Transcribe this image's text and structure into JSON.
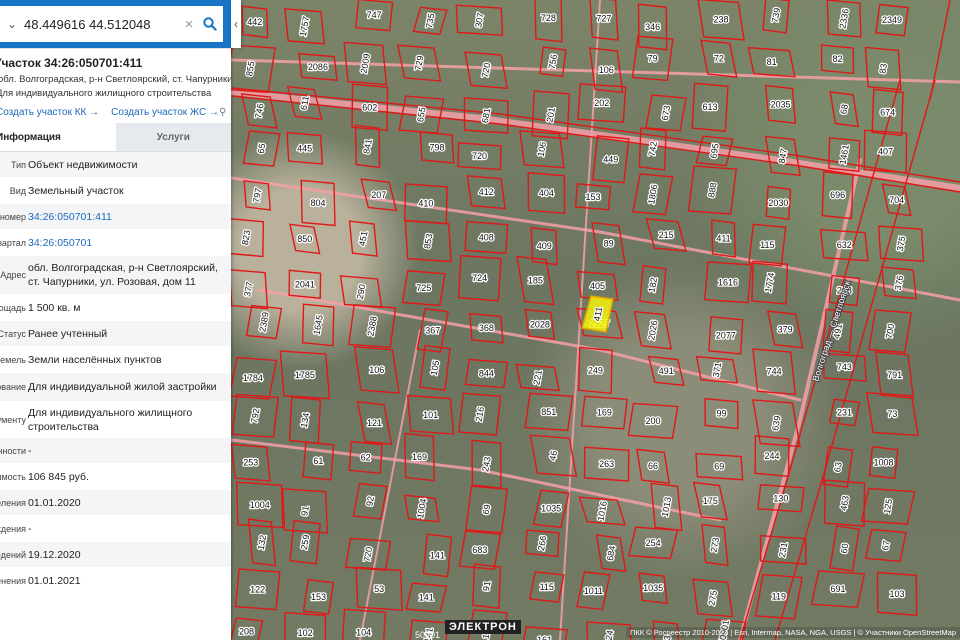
{
  "search": {
    "value": "48.449616 44.512048"
  },
  "object": {
    "title": "Участок 34:26:050701:411",
    "address": "обл. Волгоградская, р-н Светлоярский, ст. Чапурники, ул. Розовая, дом 11",
    "type": "Для индивидуального жилищного строительства"
  },
  "links": {
    "link1": "Создать участок КК",
    "link2": "Создать участок ЖС"
  },
  "tabs": {
    "active": "Информация",
    "other": "Услуги"
  },
  "rows": [
    {
      "key": "Тип",
      "value": "Объект недвижимости",
      "link": false
    },
    {
      "key": "Вид",
      "value": "Земельный участок",
      "link": false
    },
    {
      "key": "Кадастровый номер",
      "value": "34:26:050701:411",
      "link": true
    },
    {
      "key": "Кадастровый квартал",
      "value": "34:26:050701",
      "link": true
    },
    {
      "key": "Адрес",
      "value": "обл. Волгоградская, р-н Светлоярский, ст. Чапурники, ул. Розовая, дом 11",
      "link": false
    },
    {
      "key": "Площадь",
      "value": "1 500 кв. м",
      "link": false
    },
    {
      "key": "Статус",
      "value": "Ранее учтенный",
      "link": false
    },
    {
      "key": "Категория земель",
      "value": "Земли населённых пунктов",
      "link": false
    },
    {
      "key": "Разрешенное использование",
      "value": "Для индивидуальной жилой застройки",
      "link": false
    },
    {
      "key": "По документу",
      "value": "Для индивидуального жилищного строительства",
      "link": false
    },
    {
      "key": "Форма собственности",
      "value": "-",
      "link": false
    },
    {
      "key": "Кадастровая стоимость",
      "value": "106 845 руб.",
      "link": false
    },
    {
      "key": "Дата определения",
      "value": "01.01.2020",
      "link": false
    },
    {
      "key": "Дата утверждения",
      "value": "-",
      "link": false
    },
    {
      "key": "Дата внесения сведений",
      "value": "19.12.2020",
      "link": false
    },
    {
      "key": "Дата применения",
      "value": "01.01.2021",
      "link": false
    }
  ],
  "map": {
    "parcel_labels": [
      "442",
      "1757",
      "747",
      "735",
      "307",
      "728",
      "727",
      "346",
      "238",
      "739",
      "2336",
      "2349",
      "855",
      "2086",
      "2009",
      "729",
      "720",
      "756",
      "106",
      "79",
      "72",
      "81",
      "82",
      "83",
      "746",
      "611",
      "602",
      "655",
      "681",
      "201",
      "202",
      "673",
      "613",
      "2035",
      "68",
      "674",
      "65",
      "445",
      "841",
      "798",
      "720",
      "106",
      "449",
      "742",
      "695",
      "847",
      "1461",
      "407",
      "797",
      "804",
      "207",
      "410",
      "412",
      "404",
      "153",
      "1806",
      "888",
      "2030",
      "696",
      "704",
      "823",
      "850",
      "451",
      "853",
      "408",
      "409",
      "89",
      "215",
      "411",
      "115",
      "632",
      "375",
      "377",
      "2041",
      "290",
      "725",
      "724",
      "185",
      "405",
      "182",
      "1616",
      "1774",
      "208",
      "376",
      "2389",
      "1645",
      "2388",
      "367",
      "368",
      "2028",
      "2927",
      "2026",
      "2077",
      "379",
      "491",
      "700",
      "1784",
      "1785",
      "106",
      "105",
      "844",
      "221",
      "249",
      "491",
      "371",
      "744",
      "743",
      "791",
      "792",
      "134",
      "121",
      "101",
      "216",
      "851",
      "169",
      "200",
      "99",
      "639",
      "231",
      "73",
      "253",
      "61",
      "62",
      "169",
      "243",
      "46",
      "263",
      "66",
      "69",
      "244",
      "63",
      "1008",
      "1004",
      "91",
      "92",
      "1004",
      "69",
      "1035",
      "1016",
      "1013",
      "175",
      "130",
      "463",
      "125",
      "132",
      "259",
      "720",
      "141",
      "683",
      "266",
      "684",
      "254",
      "273",
      "231",
      "60",
      "67",
      "122",
      "153",
      "53",
      "141",
      "91",
      "115",
      "1011",
      "1035",
      "275",
      "119",
      "691",
      "103",
      "208",
      "102",
      "104",
      "141",
      "125",
      "161",
      "124",
      "133",
      "50901"
    ],
    "road_label": "Волгоград — Светлоярск",
    "selected_parcel": "411",
    "settlement_label": "ЭЛЕКТРОН",
    "scale_text": "50901"
  },
  "attribution": "ПКК © Росреестр 2010-2021 | Esri, Intermap, NASA, NGA, USGS | © Участники OpenStreetMap"
}
